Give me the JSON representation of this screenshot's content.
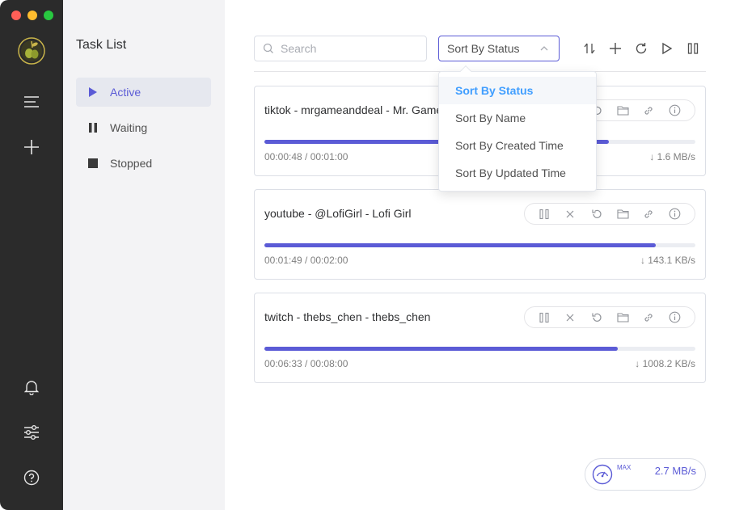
{
  "sidebar": {
    "title": "Task List",
    "items": [
      {
        "label": "Active",
        "icon": "play-icon",
        "active": true
      },
      {
        "label": "Waiting",
        "icon": "pause-icon",
        "active": false
      },
      {
        "label": "Stopped",
        "icon": "stop-icon",
        "active": false
      }
    ]
  },
  "rail": {
    "top_icons": [
      "logo-icon",
      "menu-icon",
      "add-task-icon"
    ],
    "bottom_icons": [
      "bell-icon",
      "preferences-icon",
      "help-icon"
    ]
  },
  "toolbar": {
    "search_placeholder": "Search",
    "sort_selected": "Sort By Status",
    "buttons": [
      "sort-toggle-icon",
      "add-icon",
      "refresh-icon",
      "resume-all-icon",
      "pause-all-icon"
    ]
  },
  "sort_dropdown": {
    "options": [
      "Sort By Status",
      "Sort By Name",
      "Sort By Created Time",
      "Sort By Updated Time"
    ],
    "selected": "Sort By Status"
  },
  "tasks": [
    {
      "name": "tiktok - mrgameanddeal - Mr. Game",
      "time": "00:00:48 / 00:01:00",
      "speed": "↓ 1.6 MB/s",
      "progress": 0.8
    },
    {
      "name": "youtube - @LofiGirl - Lofi Girl",
      "time": "00:01:49 / 00:02:00",
      "speed": "↓ 143.1 KB/s",
      "progress": 0.908
    },
    {
      "name": "twitch - thebs_chen - thebs_chen",
      "time": "00:06:33 / 00:08:00",
      "speed": "↓ 1008.2 KB/s",
      "progress": 0.819
    }
  ],
  "speedometer": {
    "max_label": "MAX",
    "speed": "2.7 MB/s"
  },
  "colors": {
    "accent": "#5b5bd6",
    "dropdown_selected": "#409eff",
    "rail": "#2b2b2b",
    "sidebar": "#f3f3f5"
  }
}
